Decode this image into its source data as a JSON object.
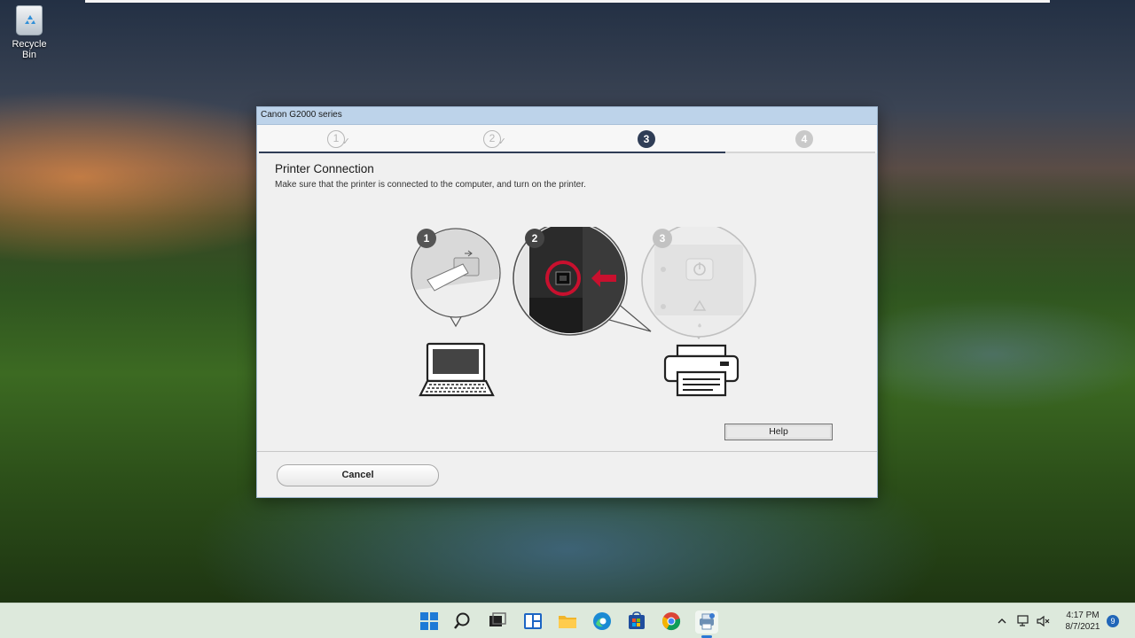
{
  "desktop": {
    "icons": [
      {
        "label": "Recycle Bin",
        "icon": "recycle-bin-icon"
      }
    ]
  },
  "dialog": {
    "title": "Canon G2000 series",
    "steps": [
      {
        "number": "1",
        "state": "completed"
      },
      {
        "number": "2",
        "state": "completed"
      },
      {
        "number": "3",
        "state": "current"
      },
      {
        "number": "4",
        "state": "upcoming"
      }
    ],
    "heading": "Printer Connection",
    "description": "Make sure that the printer is connected to the computer, and turn on the printer.",
    "illustration": {
      "callouts": [
        {
          "number": "1",
          "shows": "usb-plug-into-computer"
        },
        {
          "number": "2",
          "shows": "usb-port-on-printer"
        },
        {
          "number": "3",
          "shows": "printer-power-panel"
        }
      ],
      "devices": [
        "laptop-icon",
        "printer-icon"
      ]
    },
    "help_label": "Help",
    "cancel_label": "Cancel"
  },
  "taskbar": {
    "apps": [
      "start-icon",
      "search-icon",
      "task-view-icon",
      "widgets-icon",
      "file-explorer-icon",
      "edge-icon",
      "store-icon",
      "chrome-icon",
      "printer-setup-icon"
    ],
    "active_app": "printer-setup-icon",
    "clock": {
      "time": "4:17 PM",
      "date": "8/7/2021"
    },
    "notification_count": "9"
  },
  "colors": {
    "accent": "#2f3d56",
    "titlebar": "#bdd3ea",
    "callout_red": "#c8102e"
  }
}
